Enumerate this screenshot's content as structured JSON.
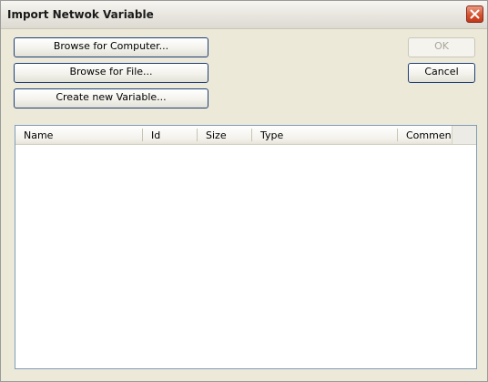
{
  "window": {
    "title": "Import Netwok Variable"
  },
  "buttons": {
    "browse_computer": "Browse for Computer...",
    "browse_file": "Browse for File...",
    "create_variable": "Create new Variable...",
    "ok": "OK",
    "cancel": "Cancel"
  },
  "list": {
    "columns": [
      "Name",
      "Id",
      "Size",
      "Type",
      "Comment"
    ],
    "rows": []
  },
  "icons": {
    "close": "close-icon"
  }
}
